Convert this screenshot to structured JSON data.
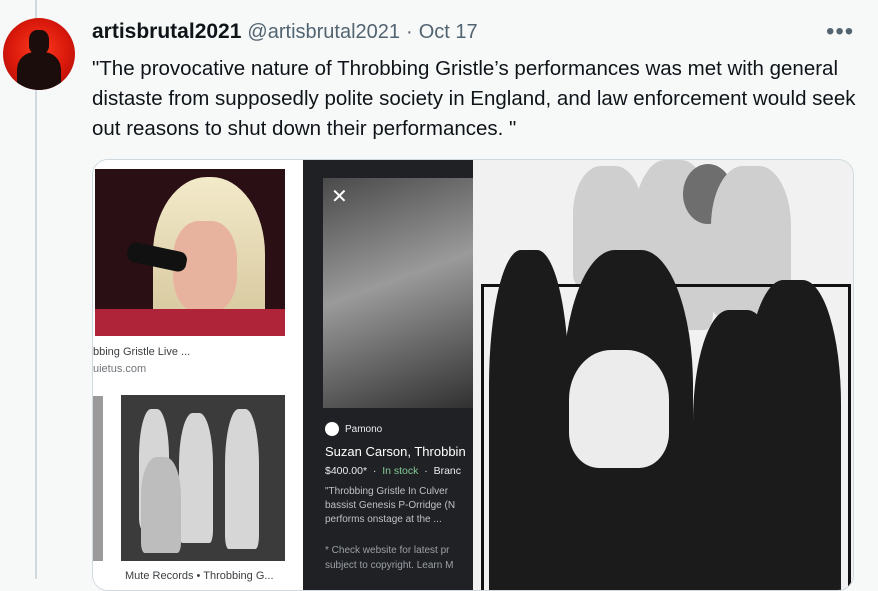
{
  "tweet": {
    "display_name": "artisbrutal2021",
    "handle": "@artisbrutal2021",
    "separator": "·",
    "date": "Oct 17",
    "more": "•••",
    "text": "\"The provocative nature of Throbbing Gristle’s performances was met with general distaste from supposedly polite society in England, and law enforcement would seek out reasons to shut down their performances. \""
  },
  "media": {
    "result1_caption": "bbing Gristle Live ...",
    "result1_source": "uietus.com",
    "result2_caption": "Mute Records • Throbbing G...",
    "product": {
      "close": "✕",
      "source": "Pamono",
      "title": "Suzan Carson, Throbbin",
      "price": "$400.00*",
      "stock": "In stock",
      "brand": "Branc",
      "desc_lines": [
        "\"Throbbing Gristle In Culver",
        "bassist Genesis P-Orridge (N",
        "performs onstage at the ..."
      ],
      "note_lines": [
        "* Check website for latest pr",
        "subject to copyright. Learn M"
      ]
    }
  }
}
